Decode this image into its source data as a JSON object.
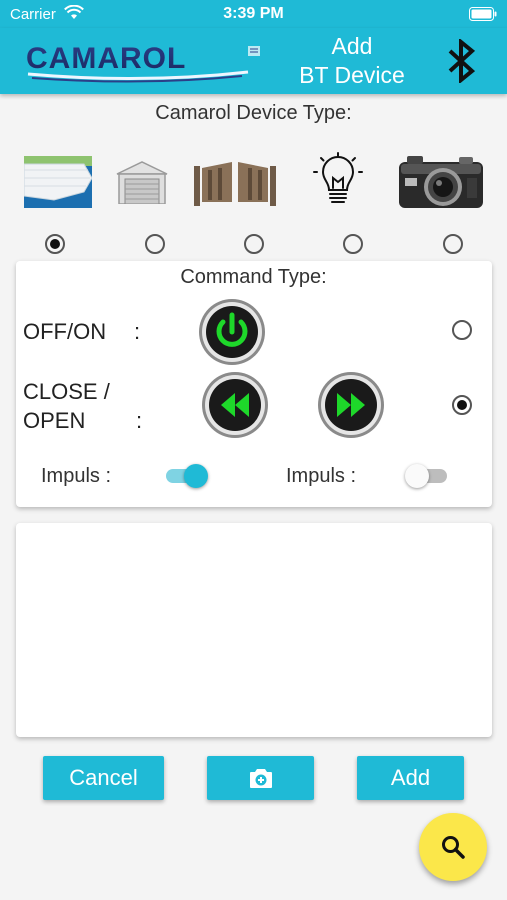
{
  "status_bar": {
    "carrier": "Carrier",
    "time": "3:39 PM"
  },
  "header": {
    "logo_text": "CAMAROL",
    "title_line1": "Add",
    "title_line2": "BT Device",
    "bluetooth_icon": "bluetooth-icon"
  },
  "device_type": {
    "label": "Camarol Device Type:",
    "options": [
      {
        "icon": "pool-cover-icon",
        "selected": true
      },
      {
        "icon": "garage-door-icon",
        "selected": false
      },
      {
        "icon": "gate-icon",
        "selected": false
      },
      {
        "icon": "light-bulb-icon",
        "selected": false
      },
      {
        "icon": "camera-icon",
        "selected": false
      }
    ]
  },
  "command_type": {
    "label": "Command Type:",
    "off_on": {
      "label": "OFF/ON",
      "colon": ":",
      "selected": false,
      "icon": "power-icon"
    },
    "close_open": {
      "label_line1": "CLOSE /",
      "label_line2": "OPEN",
      "colon": ":",
      "selected": true,
      "close_icon": "rewind-icon",
      "open_icon": "fast-forward-icon"
    },
    "impuls_left": {
      "label": "Impuls :",
      "on": true
    },
    "impuls_right": {
      "label": "Impuls :",
      "on": false
    }
  },
  "buttons": {
    "cancel": "Cancel",
    "photo_icon": "add-photo-icon",
    "add": "Add",
    "search_icon": "search-icon"
  },
  "colors": {
    "primary": "#1fbad6",
    "fab": "#fbe74a",
    "green_icon": "#1ed82a"
  }
}
